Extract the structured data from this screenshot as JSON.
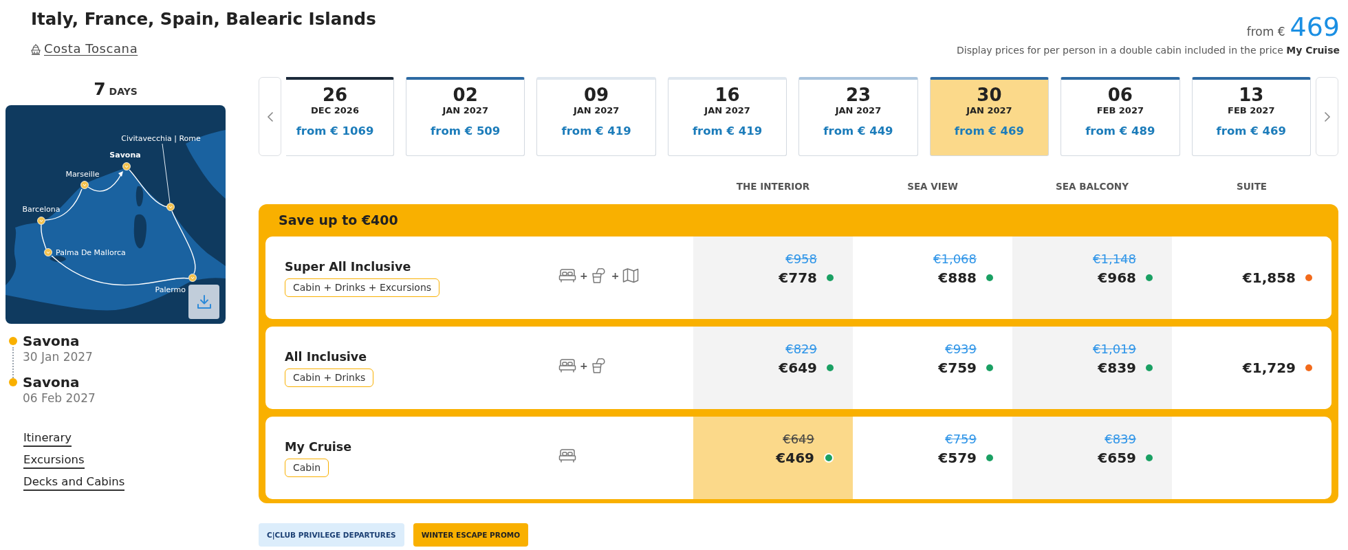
{
  "header": {
    "title": "Italy, France, Spain, Balearic Islands",
    "ship": "Costa Toscana",
    "price_prefix": "from €",
    "price": "469",
    "note": "Display prices for per person in a double cabin included in the price **My Cruise**"
  },
  "sidebar": {
    "duration": {
      "value": "7",
      "unit": "DAYS"
    },
    "map": {
      "ports": [
        {
          "name": "Civitavecchia | Rome",
          "kind": "stop"
        },
        {
          "name": "Savona",
          "kind": "home"
        },
        {
          "name": "Marseille",
          "kind": "stop"
        },
        {
          "name": "Barcelona",
          "kind": "stop"
        },
        {
          "name": "Palma De Mallorca",
          "kind": "stop"
        },
        {
          "name": "Palermo",
          "kind": "stop"
        }
      ]
    },
    "itinerary": [
      {
        "port": "Savona",
        "date": "30 Jan 2027"
      },
      {
        "port": "Savona",
        "date": "06 Feb 2027"
      }
    ],
    "links": [
      "Itinerary",
      "Excursions",
      "Decks and Cabins"
    ]
  },
  "dates": [
    {
      "day": "26",
      "month": "DEC 2026",
      "price": "from € 1069",
      "color": "#1b2a3a",
      "selected": false
    },
    {
      "day": "02",
      "month": "JAN 2027",
      "price": "from € 509",
      "color": "#2d6aa3",
      "selected": false
    },
    {
      "day": "09",
      "month": "JAN 2027",
      "price": "from € 419",
      "color": "#dfe7ef",
      "selected": false
    },
    {
      "day": "16",
      "month": "JAN 2027",
      "price": "from € 419",
      "color": "#dfe7ef",
      "selected": false
    },
    {
      "day": "23",
      "month": "JAN 2027",
      "price": "from € 449",
      "color": "#a9c3dd",
      "selected": false
    },
    {
      "day": "30",
      "month": "JAN 2027",
      "price": "from € 469",
      "color": "#2d6aa3",
      "selected": true
    },
    {
      "day": "06",
      "month": "FEB 2027",
      "price": "from € 489",
      "color": "#2d6aa3",
      "selected": false
    },
    {
      "day": "13",
      "month": "FEB 2027",
      "price": "from € 469",
      "color": "#2d6aa3",
      "selected": false
    }
  ],
  "cabin_columns": [
    "THE INTERIOR",
    "SEA VIEW",
    "SEA BALCONY",
    "SUITE"
  ],
  "promotion": {
    "title": "Save up to €400",
    "fares": [
      {
        "name": "Super All Inclusive",
        "tag": "Cabin + Drinks + Excursions",
        "inclusions": [
          {
            "kind": "cabin"
          },
          {
            "kind": "drinks",
            "joiner": "+"
          },
          {
            "kind": "excursions",
            "joiner": "+"
          }
        ],
        "prices": [
          {
            "old": "€958",
            "price": "€778",
            "color": "#1aa063",
            "selected": false
          },
          {
            "old": "€1,068",
            "price": "€888",
            "color": "#1aa063",
            "selected": false
          },
          {
            "old": "€1,148",
            "price": "€968",
            "color": "#1aa063",
            "selected": false
          },
          {
            "price": "€1,858",
            "color": "#f26a1b",
            "selected": false
          }
        ]
      },
      {
        "name": "All Inclusive",
        "tag": "Cabin + Drinks",
        "inclusions": [
          {
            "kind": "cabin"
          },
          {
            "kind": "drinks",
            "joiner": "+"
          }
        ],
        "prices": [
          {
            "old": "€829",
            "price": "€649",
            "color": "#1aa063",
            "selected": false
          },
          {
            "old": "€939",
            "price": "€759",
            "color": "#1aa063",
            "selected": false
          },
          {
            "old": "€1,019",
            "price": "€839",
            "color": "#1aa063",
            "selected": false
          },
          {
            "price": "€1,729",
            "color": "#f26a1b",
            "selected": false
          }
        ]
      },
      {
        "name": "My Cruise",
        "tag": "Cabin",
        "inclusions": [
          {
            "kind": "cabin"
          }
        ],
        "prices": [
          {
            "old": "€649",
            "price": "€469",
            "color": "#1aa063",
            "selected": true
          },
          {
            "old": "€759",
            "price": "€579",
            "color": "#1aa063",
            "selected": false
          },
          {
            "old": "€839",
            "price": "€659",
            "color": "#1aa063",
            "selected": false
          }
        ]
      }
    ]
  },
  "tags": [
    {
      "label": "C|CLUB PRIVILEGE DEPARTURES",
      "kind": "club"
    },
    {
      "label": "WINTER ESCAPE PROMO",
      "kind": "promo"
    }
  ]
}
